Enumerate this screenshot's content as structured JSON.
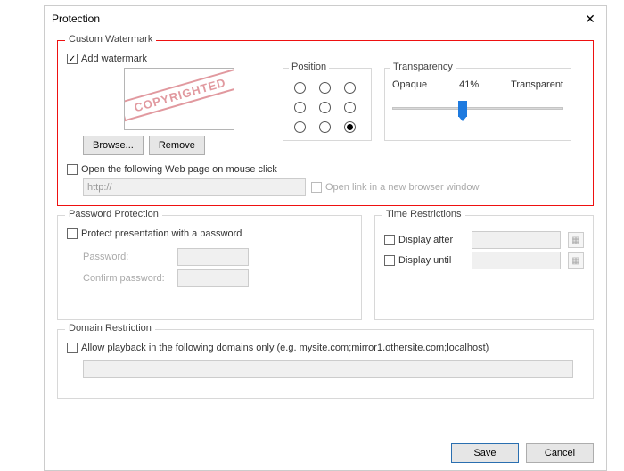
{
  "title": "Protection",
  "custom_watermark": {
    "legend": "Custom Watermark",
    "add_watermark_label": "Add watermark",
    "add_watermark_checked": true,
    "stamp_text": "COPYRIGHTED",
    "browse_btn": "Browse...",
    "remove_btn": "Remove",
    "position": {
      "legend": "Position",
      "selected_index": 8
    },
    "transparency": {
      "legend": "Transparency",
      "opaque_label": "Opaque",
      "percent_label": "41%",
      "percent_value": 41,
      "transparent_label": "Transparent"
    },
    "open_web": {
      "label": "Open the following Web page on mouse click",
      "checked": false,
      "value": "http://",
      "new_window_label": "Open link in a new browser window",
      "new_window_checked": false
    }
  },
  "password": {
    "legend": "Password Protection",
    "protect_label": "Protect presentation with a password",
    "protect_checked": false,
    "password_label": "Password:",
    "confirm_label": "Confirm password:"
  },
  "time": {
    "legend": "Time Restrictions",
    "display_after_label": "Display after",
    "display_after_checked": false,
    "display_until_label": "Display until",
    "display_until_checked": false
  },
  "domain": {
    "legend": "Domain Restriction",
    "allow_label": "Allow playback in the following domains only (e.g. mysite.com;mirror1.othersite.com;localhost)",
    "allow_checked": false
  },
  "footer": {
    "save": "Save",
    "cancel": "Cancel"
  }
}
